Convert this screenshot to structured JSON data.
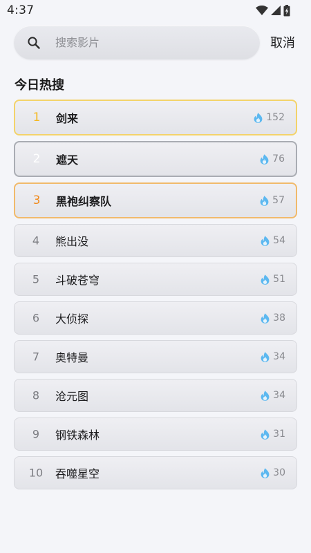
{
  "status_bar": {
    "time": "4:37",
    "icons": [
      "wifi-icon",
      "cell-signal-icon",
      "battery-icon"
    ]
  },
  "search": {
    "placeholder": "搜索影片",
    "value": "",
    "cancel_label": "取消"
  },
  "section": {
    "title": "今日热搜"
  },
  "colors": {
    "rank_gold": "#f5b81e",
    "rank_silver": "#a9acb3",
    "rank_bronze": "#f08a1c",
    "flame": "#5cb8f0",
    "background": "#f4f5f9"
  },
  "hot_list": [
    {
      "rank": "1",
      "title": "剑来",
      "heat": "152"
    },
    {
      "rank": "2",
      "title": "遮天",
      "heat": "76"
    },
    {
      "rank": "3",
      "title": "黑袍纠察队",
      "heat": "57"
    },
    {
      "rank": "4",
      "title": "熊出没",
      "heat": "54"
    },
    {
      "rank": "5",
      "title": "斗破苍穹",
      "heat": "51"
    },
    {
      "rank": "6",
      "title": "大侦探",
      "heat": "38"
    },
    {
      "rank": "7",
      "title": "奥特曼",
      "heat": "34"
    },
    {
      "rank": "8",
      "title": "沧元图",
      "heat": "34"
    },
    {
      "rank": "9",
      "title": "钢铁森林",
      "heat": "31"
    },
    {
      "rank": "10",
      "title": "吞噬星空",
      "heat": "30"
    }
  ]
}
